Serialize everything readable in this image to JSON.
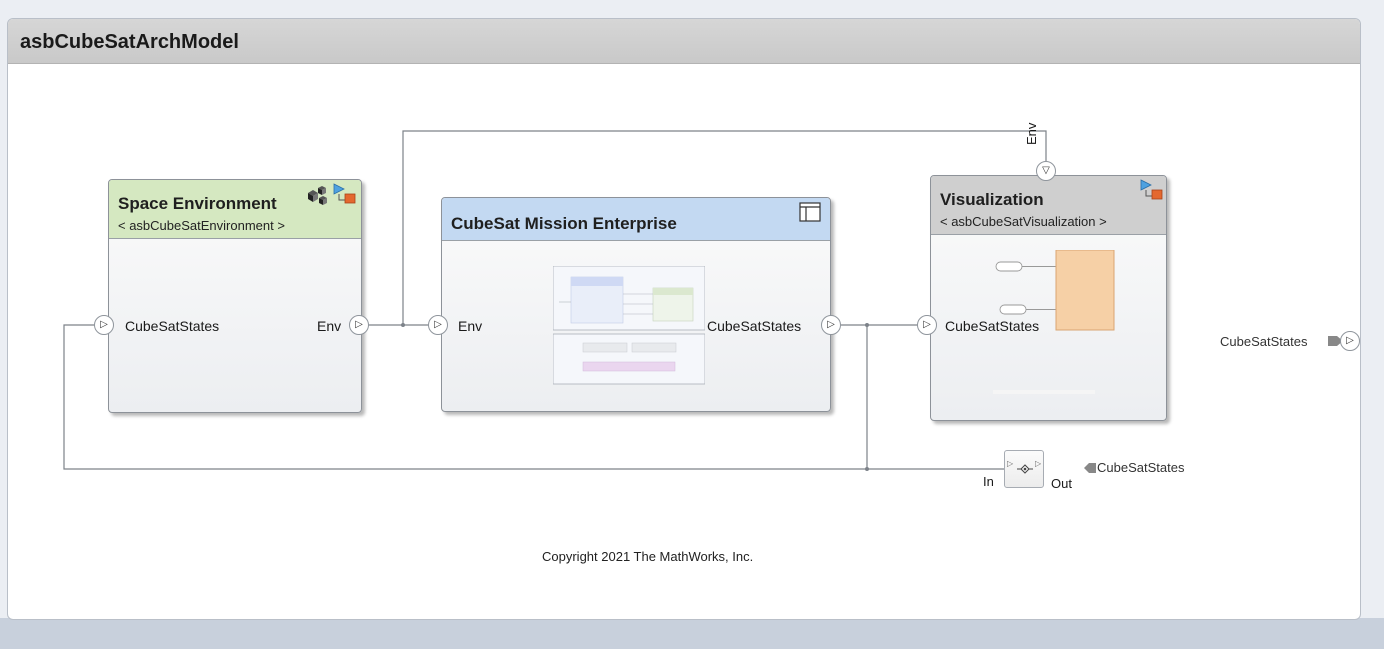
{
  "model": {
    "title": "asbCubeSatArchModel"
  },
  "blocks": {
    "space_environment": {
      "title": "Space Environment",
      "subtitle": "< asbCubeSatEnvironment >",
      "input_port": "CubeSatStates",
      "output_port": "Env",
      "header_color": "#d5e8c1"
    },
    "mission_enterprise": {
      "title": "CubeSat Mission Enterprise",
      "input_port": "Env",
      "output_port": "CubeSatStates",
      "header_color": "#c3d9f2"
    },
    "visualization": {
      "title": "Visualization",
      "subtitle": "< asbCubeSatVisualization >",
      "input_port_left": "CubeSatStates",
      "input_port_top": "Env",
      "header_color": "#cfcfcf"
    },
    "adapter": {
      "in_label": "In",
      "out_label": "Out",
      "icon": "adapter-icon"
    }
  },
  "ports": {
    "root_out": "CubeSatStates",
    "adapter_out": "CubeSatStates"
  },
  "copyright": "Copyright 2021 The MathWorks, Inc.",
  "colors": {
    "wire": "#7d8289",
    "behavior_orange": "#f6d0a6",
    "port_marker_blue": "#4ea1e0",
    "port_marker_red": "#e4682f"
  }
}
